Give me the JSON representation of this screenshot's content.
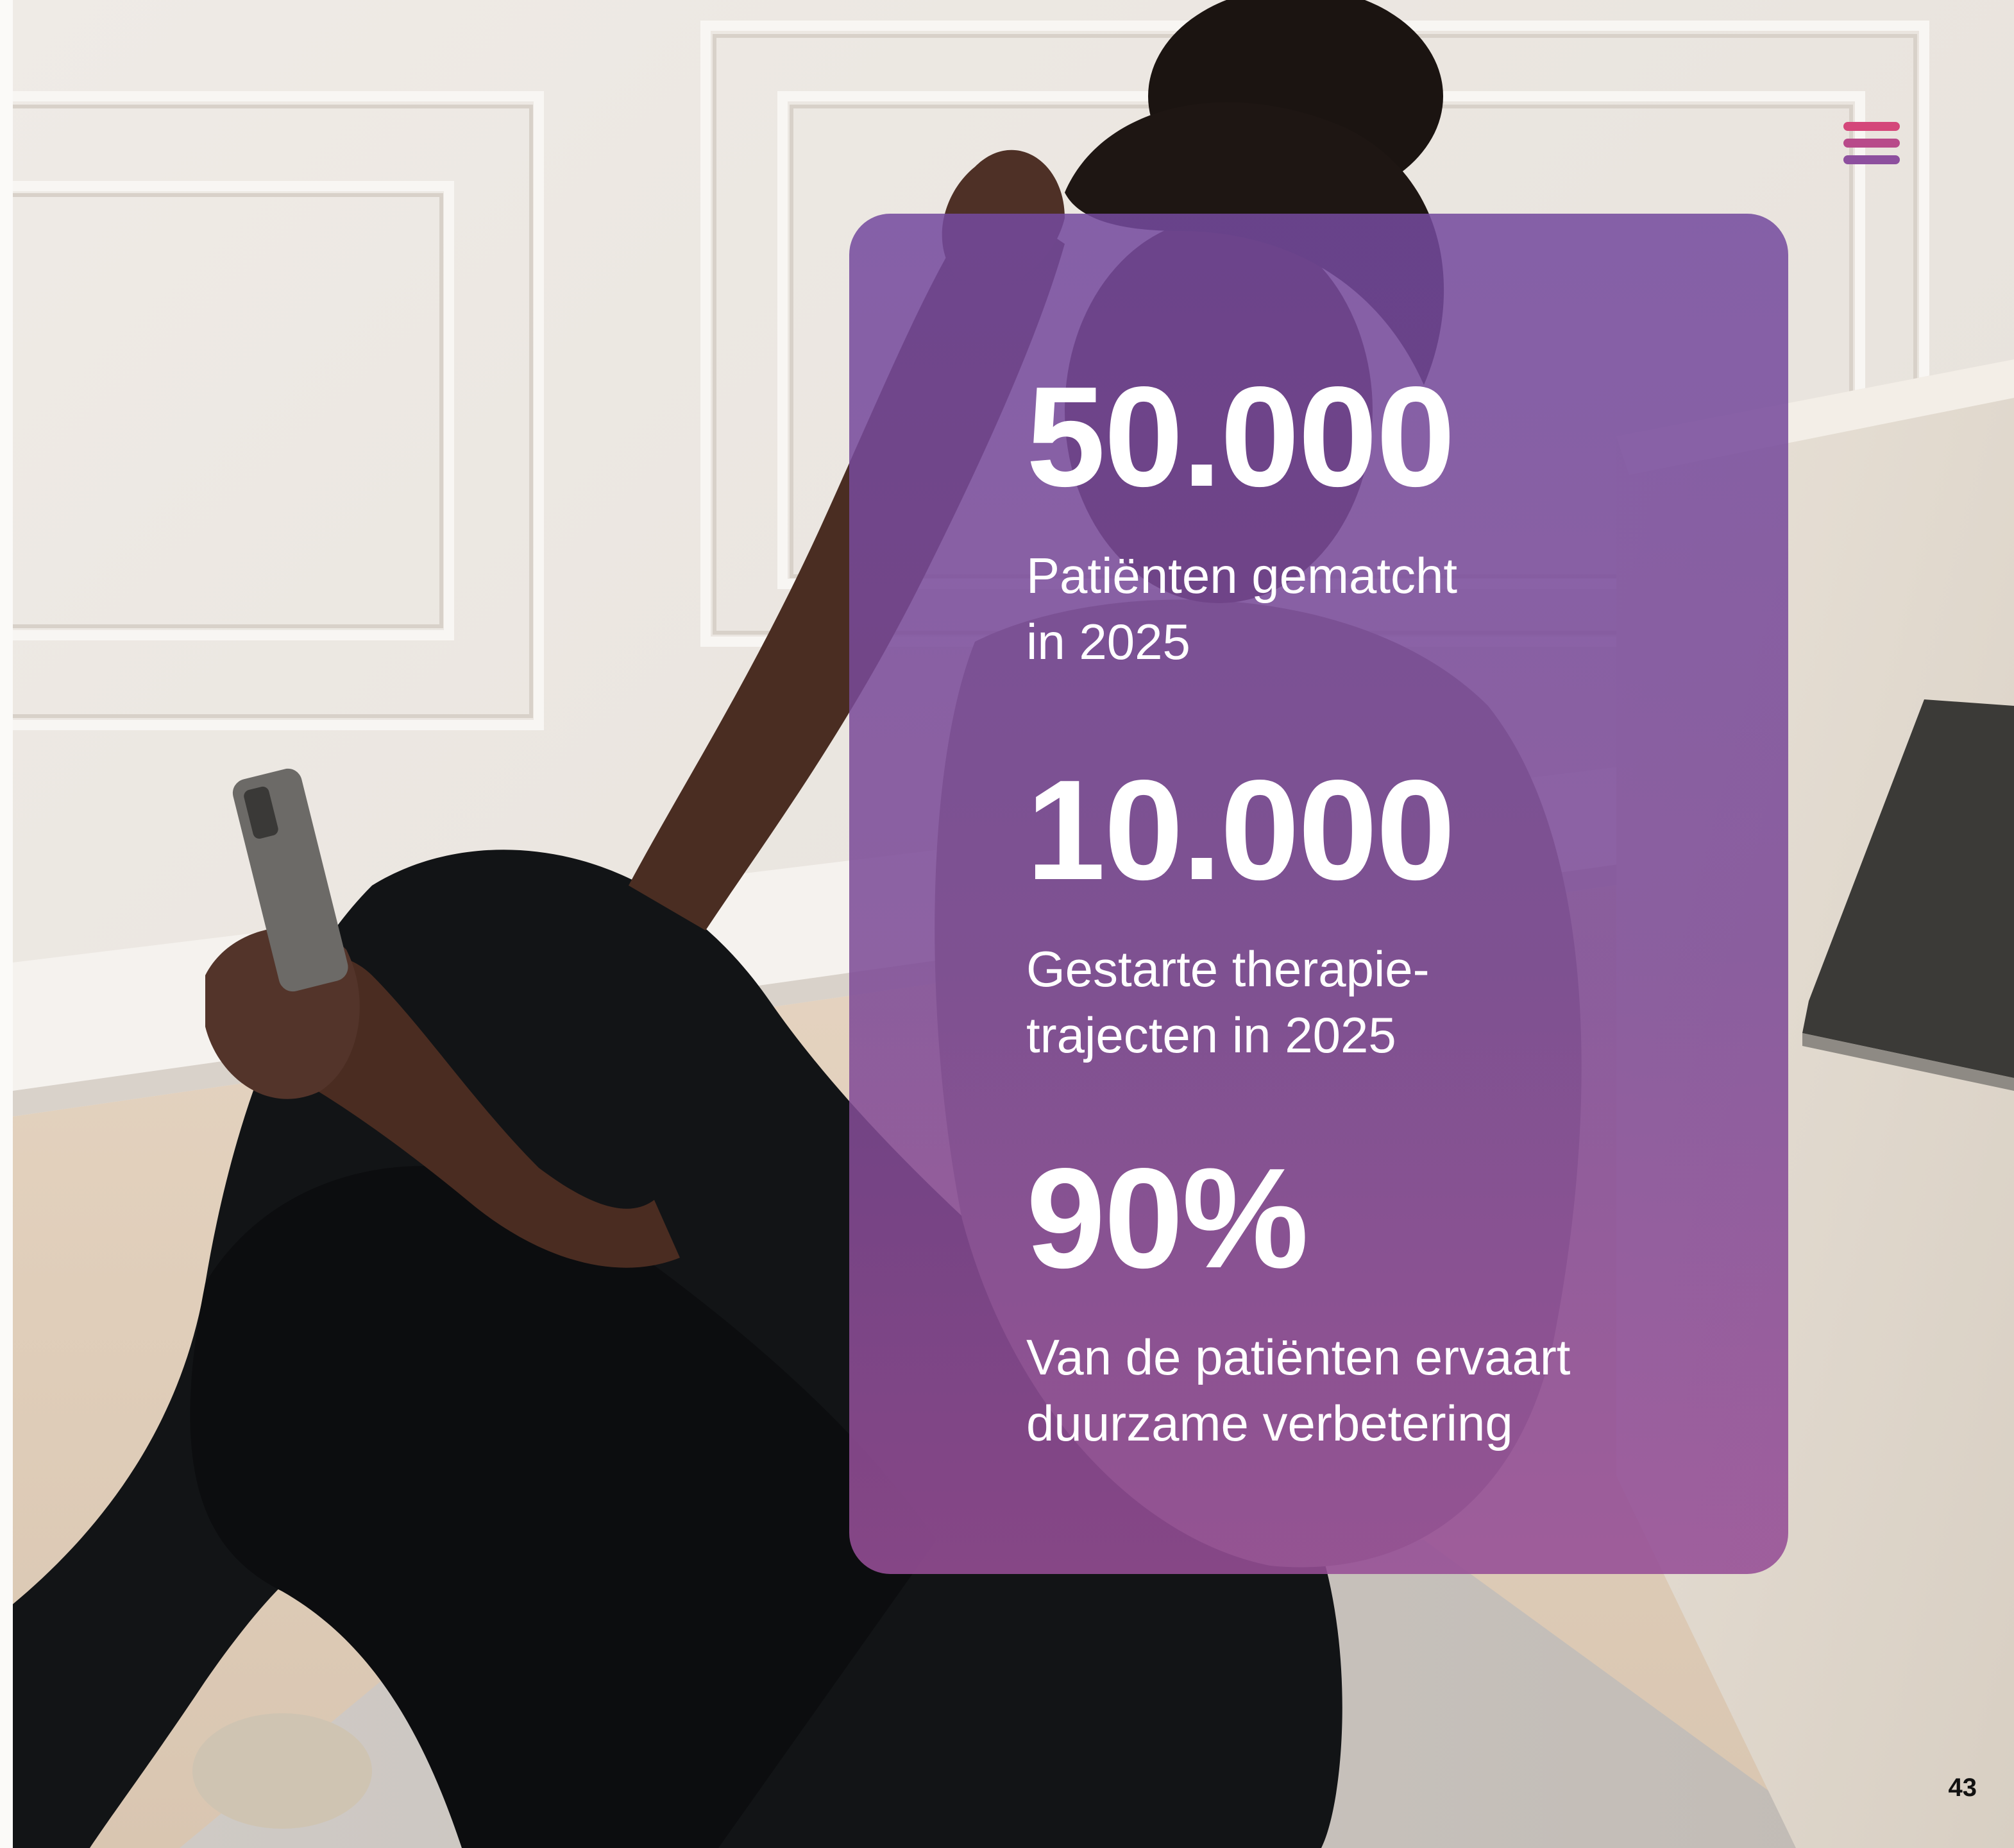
{
  "stats": [
    {
      "value": "50.000",
      "label": "Patiënten gematcht\nin 2025"
    },
    {
      "value": "10.000",
      "label": "Gestarte therapie-\ntrajecten in 2025"
    },
    {
      "value": "90%",
      "label": "Van de patiënten ervaart\nduurzame verbetering"
    }
  ],
  "menu": {
    "icon": "hamburger-menu-icon"
  },
  "page_number": "43",
  "colors": {
    "card_top": "#744a9e",
    "card_bottom": "#964e96",
    "menu_bar_1": "#d4477a",
    "menu_bar_2": "#b84a8a",
    "menu_bar_3": "#8d4f9e",
    "text_on_card": "#ffffff"
  }
}
